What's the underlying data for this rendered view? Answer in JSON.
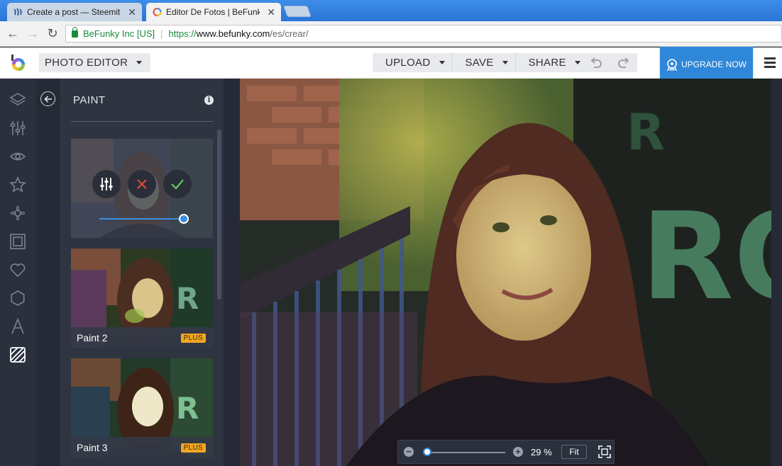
{
  "browser": {
    "tabs": [
      {
        "title": "Create a post — Steemit",
        "active": false
      },
      {
        "title": "Editor De Fotos | BeFunky",
        "active": true
      }
    ],
    "address": {
      "secure_label": "BeFunky Inc [US]",
      "url_scheme": "https://",
      "url_host": "www.befunky.com",
      "url_path": "/es/crear/"
    }
  },
  "header": {
    "mode_label": "PHOTO EDITOR",
    "actions": [
      "UPLOAD",
      "SAVE",
      "SHARE"
    ],
    "upgrade_label": "UPGRADE NOW"
  },
  "rail": {
    "icons": [
      "layers-icon",
      "adjust-sliders-icon",
      "eye-icon",
      "star-icon",
      "artsy-icon",
      "frame-icon",
      "heart-icon",
      "shape-icon",
      "text-icon",
      "texture-icon"
    ]
  },
  "panel": {
    "title": "PAINT",
    "active_effect": {
      "slider_value": 0.93
    },
    "effects": [
      {
        "name": "Paint 2",
        "badge": "PLUS"
      },
      {
        "name": "Paint 3",
        "badge": "PLUS"
      }
    ]
  },
  "zoom": {
    "percent_label": "29 %",
    "fit_label": "Fit",
    "slider_value": 0.29
  },
  "colors": {
    "accent": "#2e87d8",
    "badge": "#f5a623",
    "rail_bg": "#2b303d",
    "panel_bg": "#2f3441"
  }
}
